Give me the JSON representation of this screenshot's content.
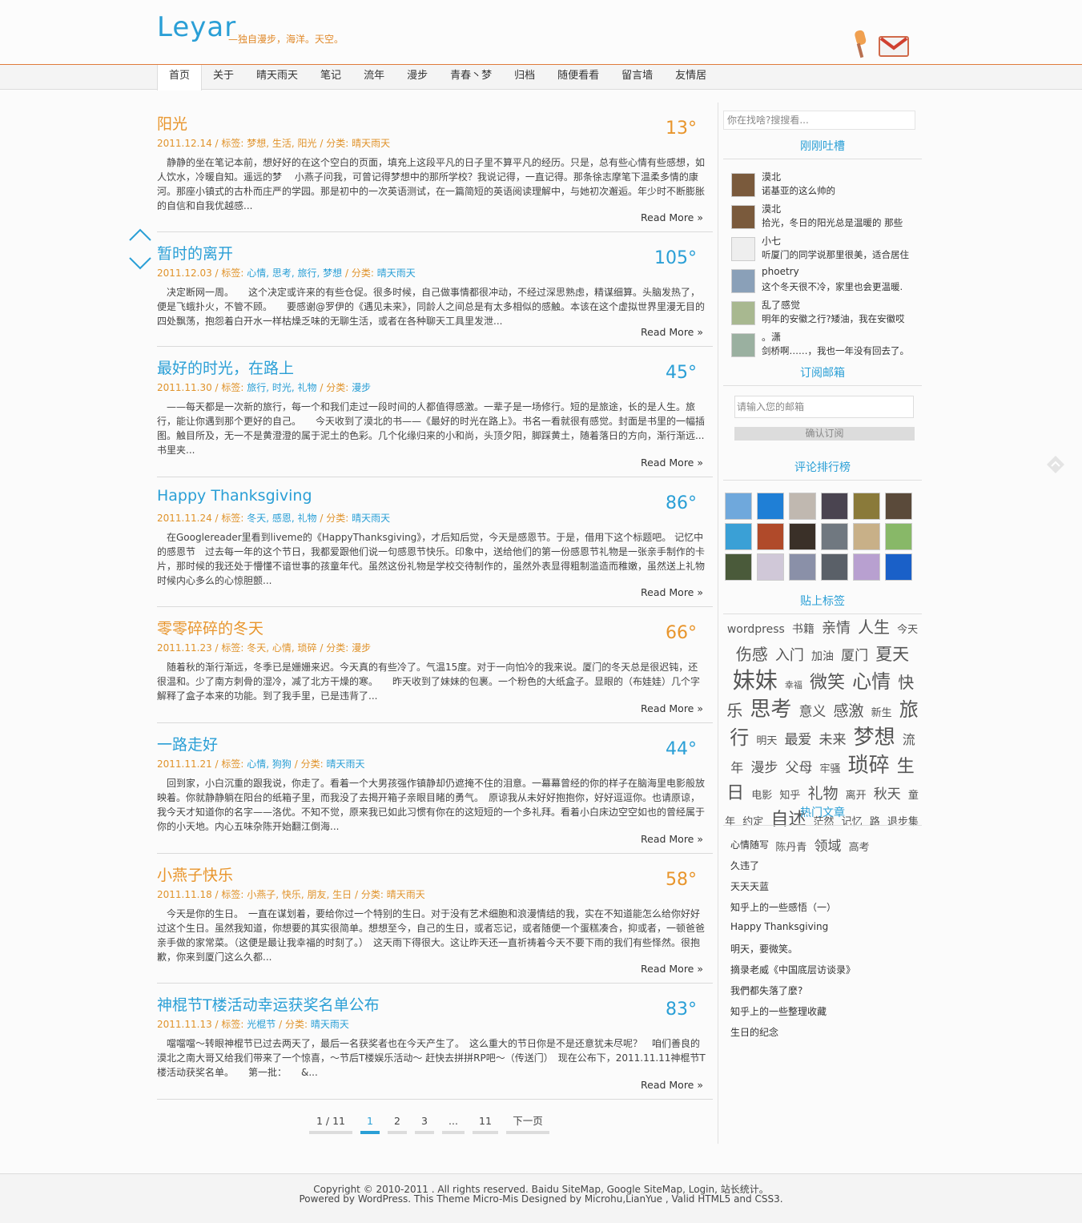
{
  "site": {
    "logo": "Leyar",
    "tagline": "—独自漫步，海洋。天空。",
    "icons": [
      "tool-icon",
      "mail-icon"
    ]
  },
  "nav": [
    "首页",
    "关于",
    "晴天雨天",
    "笔记",
    "流年",
    "漫步",
    "青春丶梦",
    "归档",
    "随便看看",
    "留言墙",
    "友情居"
  ],
  "posts": [
    {
      "title": "阳光",
      "color": "orange",
      "temp": "13°",
      "date": "2011.12.14",
      "tags_label": "标签:",
      "tags": "梦想, 生活, 阳光",
      "cat_label": "分类:",
      "cat": "晴天雨天",
      "excerpt": "静静的坐在笔记本前，想好好的在这个空白的页面，填充上这段平凡的日子里不算平凡的经历。只是，总有些心情有些感想，如人饮水，冷暖自知。遥远的梦　 小燕子问我，可曾记得梦想中的那所学校？我说记得，一直记得。那条徐志摩笔下温柔多情的康河。那座小镇式的古朴而庄严的学园。那是初中的一次英语测试，在一篇简短的英语阅读理解中，与她初次邂逅。年少时不断膨胀的自信和自我优越感...",
      "read_more": "Read More »"
    },
    {
      "title": "暂时的离开",
      "color": "blue",
      "temp": "105°",
      "date": "2011.12.03",
      "tags_label": "标签:",
      "tags": "心情, 思考, 旅行, 梦想",
      "cat_label": "分类:",
      "cat": "晴天雨天",
      "excerpt": "决定断网一周。　　这个决定或许来的有些仓促。很多时候，自己做事情都很冲动，不经过深思熟虑，精谋细算。头脑发热了，便是飞蛾扑火，不管不顾。　　要感谢@罗伊的《遇见未来》，同龄人之间总是有太多相似的感触。本该在这个虚拟世界里漫无目的四处飘荡，抱怨着白开水一样枯燥乏味的无聊生活，或者在各种聊天工具里发泄...",
      "read_more": "Read More »"
    },
    {
      "title": "最好的时光，在路上",
      "color": "blue",
      "temp": "45°",
      "date": "2011.11.30",
      "tags_label": "标签:",
      "tags": "旅行, 时光, 礼物",
      "cat_label": "分类:",
      "cat": "漫步",
      "excerpt": "——每天都是一次新的旅行，每一个和我们走过一段时间的人都值得感激。一辈子是一场修行。短的是旅途，长的是人生。旅行，能让你遇到那个更好的自己。　　今天收到了漠北的书——《最好的时光在路上》。书名一看就很有感觉。封面是书里的一幅插图。触目所及，无一不是黄澄澄的属于泥土的色彩。几个化缘归来的小和尚，头顶夕阳，脚踩黄土，随着落日的方向，渐行渐远...　　书里夹...",
      "read_more": "Read More »"
    },
    {
      "title": "Happy Thanksgiving",
      "color": "blue",
      "temp": "86°",
      "date": "2011.11.24",
      "tags_label": "标签:",
      "tags": "冬天, 感恩, 礼物",
      "cat_label": "分类:",
      "cat": "晴天雨天",
      "excerpt": "在Googlereader里看到liveme的《HappyThanksgiving》，才后知后觉，今天是感恩节。于是，借用下这个标题吧。 记忆中的感恩节　过去每一年的这个节日，我都爱跟他们说一句感恩节快乐。印象中，送给他们的第一份感恩节礼物是一张亲手制作的卡片，那时候的我还处于懵懂不谙世事的孩童年代。虽然这份礼物是学校交待制作的，虽然外表显得粗制滥造而稚嫩，虽然送上礼物时候内心多么的心惊胆颤...",
      "read_more": "Read More »"
    },
    {
      "title": "零零碎碎的冬天",
      "color": "orange",
      "temp": "66°",
      "date": "2011.11.23",
      "tags_label": "标签:",
      "tags": "冬天, 心情, 琐碎",
      "cat_label": "分类:",
      "cat": "漫步",
      "excerpt": "随着秋的渐行渐远，冬季已是姗姗来迟。今天真的有些冷了。气温15度。对于一向怕冷的我来说。厦门的冬天总是很迟钝，还很温和。少了南方刺骨的湿冷，减了北方干燥的寒。　　昨天收到了妹妹的包裹。一个粉色的大纸盒子。显眼的（布娃娃）几个字解释了盒子本来的功能。到了我手里，已是违背了...",
      "read_more": "Read More »"
    },
    {
      "title": "一路走好",
      "color": "blue",
      "temp": "44°",
      "date": "2011.11.21",
      "tags_label": "标签:",
      "tags": "心情, 狗狗",
      "cat_label": "分类:",
      "cat": "晴天雨天",
      "excerpt": "回到家，小白沉重的跟我说，你走了。看着一个大男孩强作镇静却仍遮掩不住的泪意。一幕幕曾经的你的样子在脑海里电影般放映着。你就静静躺在阳台的纸箱子里，而我没了去揭开箱子亲眼目睹的勇气。　原谅我从未好好抱抱你，好好逗逗你。也请原谅，我今天才知道你的名字——洛优。不知不觉，原来我已如此习惯有你在的这短短的一个多礼拜。看着小白床边空空如也的曾经属于你的小天地。内心五味杂陈开始翻江倒海...",
      "read_more": "Read More »"
    },
    {
      "title": "小燕子快乐",
      "color": "orange",
      "temp": "58°",
      "date": "2011.11.18",
      "tags_label": "标签:",
      "tags": "小燕子, 快乐, 朋友, 生日",
      "cat_label": "分类:",
      "cat": "晴天雨天",
      "excerpt": "今天是你的生日。　一直在谋划着，要给你过一个特别的生日。对于没有艺术细胞和浪漫情结的我，实在不知道能怎么给你好好过这个生日。虽然我知道，你想要的其实很简单。想想至今，自己的生日，或者忘记，或者随便一个蛋糕凑合，抑或者，一顿爸爸亲手做的家常菜。（这便是最让我幸福的时刻了。）　这天雨下得很大。这让昨天还一直祈祷着今天不要下雨的我们有些怿然。很抱歉，你来到厦门这么久都...",
      "read_more": "Read More »"
    },
    {
      "title": "神棍节T楼活动幸运获奖名单公布",
      "color": "blue",
      "temp": "83°",
      "date": "2011.11.13",
      "tags_label": "标签:",
      "tags": "光棍节",
      "cat_label": "分类:",
      "cat": "晴天雨天",
      "excerpt": "噹噹噹～转眼神棍节已过去两天了，最后一名获奖者也在今天产生了。　这么重大的节日你是不是还意犹未尽呢？　咱们善良的漠北之南大哥又给我们带来了一个惊喜，～节后T楼娱乐活动～ 赶快去拼拼RP吧～（传送门）　现在公布下，2011.11.11神棍节T楼活动获奖名单。　　第一批：　　&...",
      "read_more": "Read More »"
    }
  ],
  "pager": [
    "1 / 11",
    "1",
    "2",
    "3",
    "...",
    "11",
    "下一页"
  ],
  "sidebar": {
    "search_placeholder": "你在找啥?搜搜看...",
    "tweets_title": "刚刚吐槽",
    "tweets": [
      {
        "name": "漠北",
        "text": "诺基亚的这么帅的",
        "avatar": "#7a5a3c"
      },
      {
        "name": "漠北",
        "text": "拾光，冬日的阳光总是温暖的 那些",
        "avatar": "#7a5a3c"
      },
      {
        "name": "小七",
        "text": "听厦门的同学说那里很美，适合居住",
        "avatar": "#eeeeee"
      },
      {
        "name": "phoetry",
        "text": "这个冬天很不冷，家里也会更温暖.",
        "avatar": "#8aa0b8"
      },
      {
        "name": "乱了感觉",
        "text": "明年的安徽之行?矮油，我在安徽哎",
        "avatar": "#a8b890"
      },
      {
        "name": "。潇",
        "text": "剑桥啊……，我也一年没有回去了。",
        "avatar": "#9ab0a0"
      }
    ],
    "subscribe_title": "订阅邮箱",
    "subscribe_placeholder": "请输入您的邮箱",
    "subscribe_button": "确认订阅",
    "rank_title": "评论排行榜",
    "rank_colors": [
      "#6fa8dc",
      "#1f7fd6",
      "#c0b8b0",
      "#4a4450",
      "#8a7a3a",
      "#5a4a3a",
      "#3aa0d6",
      "#b04a2a",
      "#3a3028",
      "#707880",
      "#c8b088",
      "#88b868",
      "#4a5a3a",
      "#d0c8d8",
      "#8a90a8",
      "#5a6068",
      "#b8a0d0",
      "#1a60c8"
    ],
    "tags_title": "贴上标签",
    "tags": [
      {
        "t": "wordpress",
        "s": 14
      },
      {
        "t": "书籍",
        "s": 14
      },
      {
        "t": "亲情",
        "s": 18
      },
      {
        "t": "人生",
        "s": 20
      },
      {
        "t": "今天",
        "s": 13
      },
      {
        "t": "伤感",
        "s": 20
      },
      {
        "t": "入门",
        "s": 18
      },
      {
        "t": "加油",
        "s": 14
      },
      {
        "t": "厦门",
        "s": 17
      },
      {
        "t": "夏天",
        "s": 21
      },
      {
        "t": "妹妹",
        "s": 28
      },
      {
        "t": "幸福",
        "s": 11
      },
      {
        "t": "微笑",
        "s": 22
      },
      {
        "t": "心情",
        "s": 24
      },
      {
        "t": "快乐",
        "s": 20
      },
      {
        "t": "思考",
        "s": 26
      },
      {
        "t": "意义",
        "s": 17
      },
      {
        "t": "感激",
        "s": 19
      },
      {
        "t": "新生",
        "s": 13
      },
      {
        "t": "旅行",
        "s": 24
      },
      {
        "t": "明天",
        "s": 13
      },
      {
        "t": "最爱",
        "s": 17
      },
      {
        "t": "未来",
        "s": 17
      },
      {
        "t": "梦想",
        "s": 26
      },
      {
        "t": "流年",
        "s": 16
      },
      {
        "t": "漫步",
        "s": 17
      },
      {
        "t": "父母",
        "s": 17
      },
      {
        "t": "牢骚",
        "s": 13
      },
      {
        "t": "琐碎",
        "s": 26
      },
      {
        "t": "生日",
        "s": 22
      },
      {
        "t": "电影",
        "s": 13
      },
      {
        "t": "知乎",
        "s": 13
      },
      {
        "t": "礼物",
        "s": 19
      },
      {
        "t": "离开",
        "s": 13
      },
      {
        "t": "秋天",
        "s": 17
      },
      {
        "t": "童年",
        "s": 13
      },
      {
        "t": "约定",
        "s": 13
      },
      {
        "t": "自述",
        "s": 22
      },
      {
        "t": "茫然",
        "s": 13
      },
      {
        "t": "记忆",
        "s": 13
      },
      {
        "t": "路",
        "s": 13
      },
      {
        "t": "退步集",
        "s": 13
      },
      {
        "t": "陈丹青",
        "s": 13
      },
      {
        "t": "领域",
        "s": 17
      },
      {
        "t": "高考",
        "s": 13
      }
    ],
    "hot_title": "热门文章",
    "hot": [
      "心情随写",
      "久违了",
      "天天天蓝",
      "知乎上的一些感悟（一）",
      "Happy Thanksgiving",
      "明天，要微笑。",
      "摘录老威《中国底层访谈录》",
      "我們都失落了麼?",
      "知乎上的一些整理收藏",
      "生日的纪念"
    ]
  },
  "footer": {
    "line1": "Copyright © 2010-2011 . All rights reserved. Baidu SiteMap, Google SiteMap, Login, 站长统计。",
    "line2": "Powered by WordPress. This Theme Micro-Mis Designed by Microhu,LianYue , Valid HTML5 and CSS3."
  }
}
